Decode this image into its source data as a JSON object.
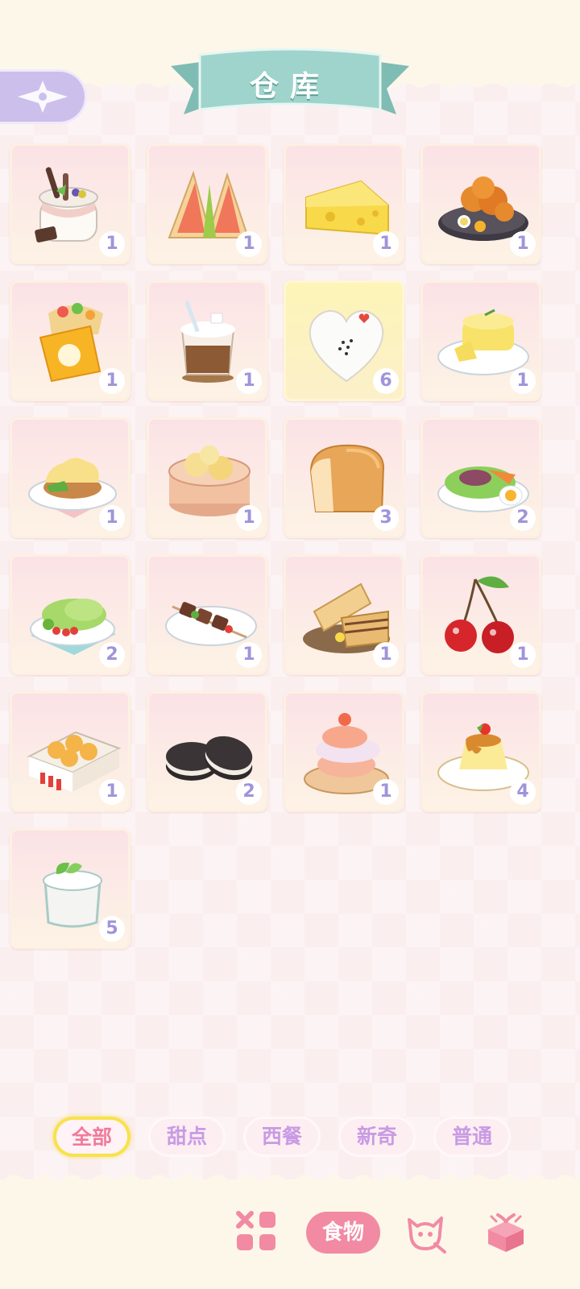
{
  "header": {
    "title": "仓库",
    "back_icon": "compass-star-back-icon"
  },
  "items": [
    {
      "name": "chocolate-pudding-jar",
      "count": "1"
    },
    {
      "name": "salmon-sandwich",
      "count": "1"
    },
    {
      "name": "cheese-wedge",
      "count": "1"
    },
    {
      "name": "fried-chicken-plate",
      "count": "1"
    },
    {
      "name": "fruit-wrap",
      "count": "1"
    },
    {
      "name": "iced-coffee",
      "count": "1"
    },
    {
      "name": "heart-rice-ball",
      "count": "6",
      "selected": true
    },
    {
      "name": "omelette-plate",
      "count": "1"
    },
    {
      "name": "eggs-benedict",
      "count": "1"
    },
    {
      "name": "shumai-steamer",
      "count": "1"
    },
    {
      "name": "bread-loaf",
      "count": "3"
    },
    {
      "name": "salad-with-egg",
      "count": "2"
    },
    {
      "name": "lettuce-salad",
      "count": "2"
    },
    {
      "name": "kebab-plate",
      "count": "1"
    },
    {
      "name": "wafer-plate",
      "count": "1"
    },
    {
      "name": "cherries",
      "count": "1"
    },
    {
      "name": "egg-tarts-box",
      "count": "1"
    },
    {
      "name": "sandwich-cookies",
      "count": "2"
    },
    {
      "name": "cream-puff",
      "count": "1"
    },
    {
      "name": "caramel-pudding",
      "count": "4"
    },
    {
      "name": "yogurt-jar",
      "count": "5"
    }
  ],
  "tabs": [
    {
      "label": "全部",
      "active": true
    },
    {
      "label": "甜点",
      "active": false
    },
    {
      "label": "西餐",
      "active": false
    },
    {
      "label": "新奇",
      "active": false
    },
    {
      "label": "普通",
      "active": false
    }
  ],
  "bottom_nav": {
    "grid_icon": "grid-icon",
    "food_label": "食物",
    "cat_icon": "cat-face-icon",
    "gift_icon": "gift-box-icon"
  },
  "colors": {
    "banner": "#9fd4cc",
    "count_text": "#9f94da",
    "active_tab_border": "#f7e24d",
    "nav_pink": "#f28aa3"
  }
}
